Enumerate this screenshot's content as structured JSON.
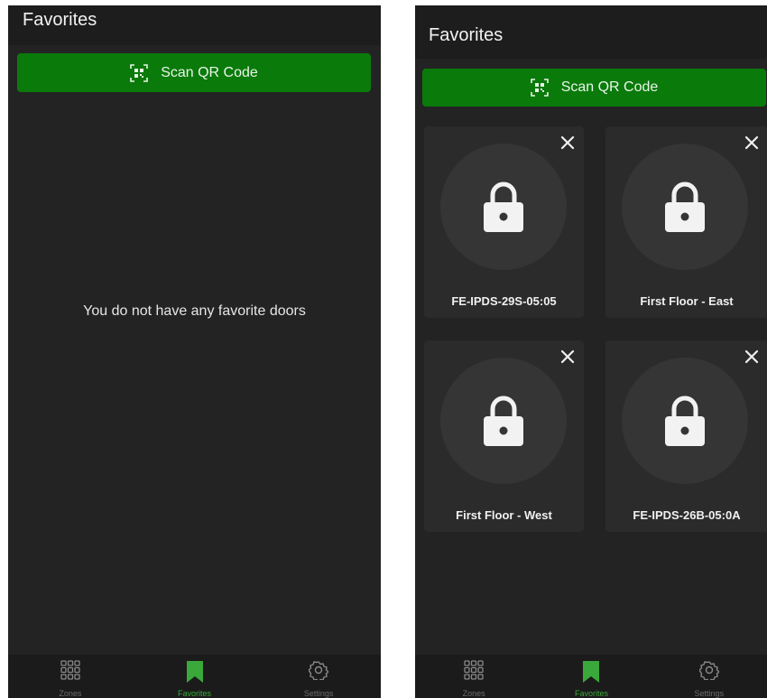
{
  "left": {
    "title": "Favorites",
    "scan_label": "Scan QR Code",
    "empty_message": "You do not have any favorite doors",
    "nav": [
      {
        "label": "Zones",
        "icon": "grid-icon"
      },
      {
        "label": "Favorites",
        "icon": "bookmark-icon",
        "active": true
      },
      {
        "label": "Settings",
        "icon": "gear-icon"
      }
    ]
  },
  "right": {
    "title": "Favorites",
    "scan_label": "Scan QR Code",
    "doors": [
      {
        "name": "FE-IPDS-29S-05:05"
      },
      {
        "name": "First Floor - East"
      },
      {
        "name": "First Floor - West"
      },
      {
        "name": "FE-IPDS-26B-05:0A"
      }
    ],
    "nav": [
      {
        "label": "Zones",
        "icon": "grid-icon"
      },
      {
        "label": "Favorites",
        "icon": "bookmark-icon",
        "active": true
      },
      {
        "label": "Settings",
        "icon": "gear-icon"
      }
    ]
  },
  "colors": {
    "accent": "#0a7a0a",
    "active_nav": "#3aa83a",
    "background": "#232323",
    "card": "#2b2b2b"
  }
}
